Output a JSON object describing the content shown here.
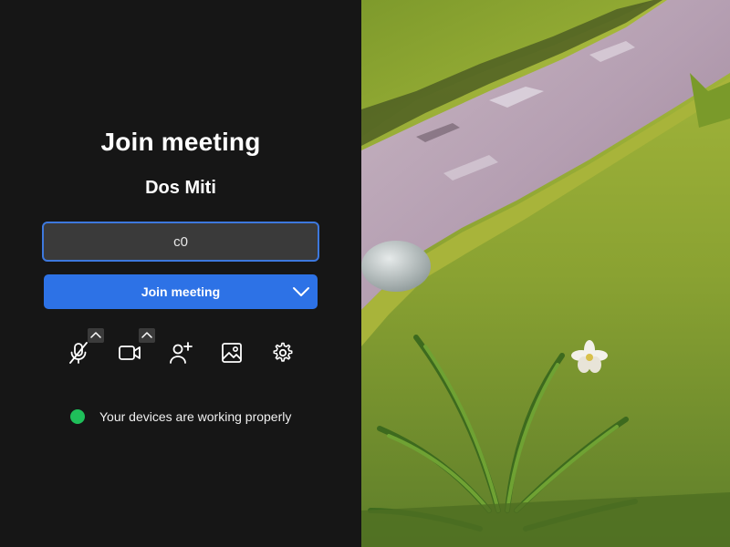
{
  "prejoin": {
    "title": "Join meeting",
    "user_name": "Dos Miti",
    "input": {
      "value": "c0",
      "placeholder": ""
    },
    "join_button_label": "Join meeting",
    "status": {
      "text": "Your devices are working properly",
      "color": "#1fbf5a"
    }
  },
  "toolbar_icons": [
    "microphone-muted-icon",
    "camera-icon",
    "invite-person-icon",
    "background-image-icon",
    "settings-gear-icon"
  ],
  "colors": {
    "background": "#161616",
    "accent": "#2d72e6",
    "focus_border": "#3d78dd"
  }
}
